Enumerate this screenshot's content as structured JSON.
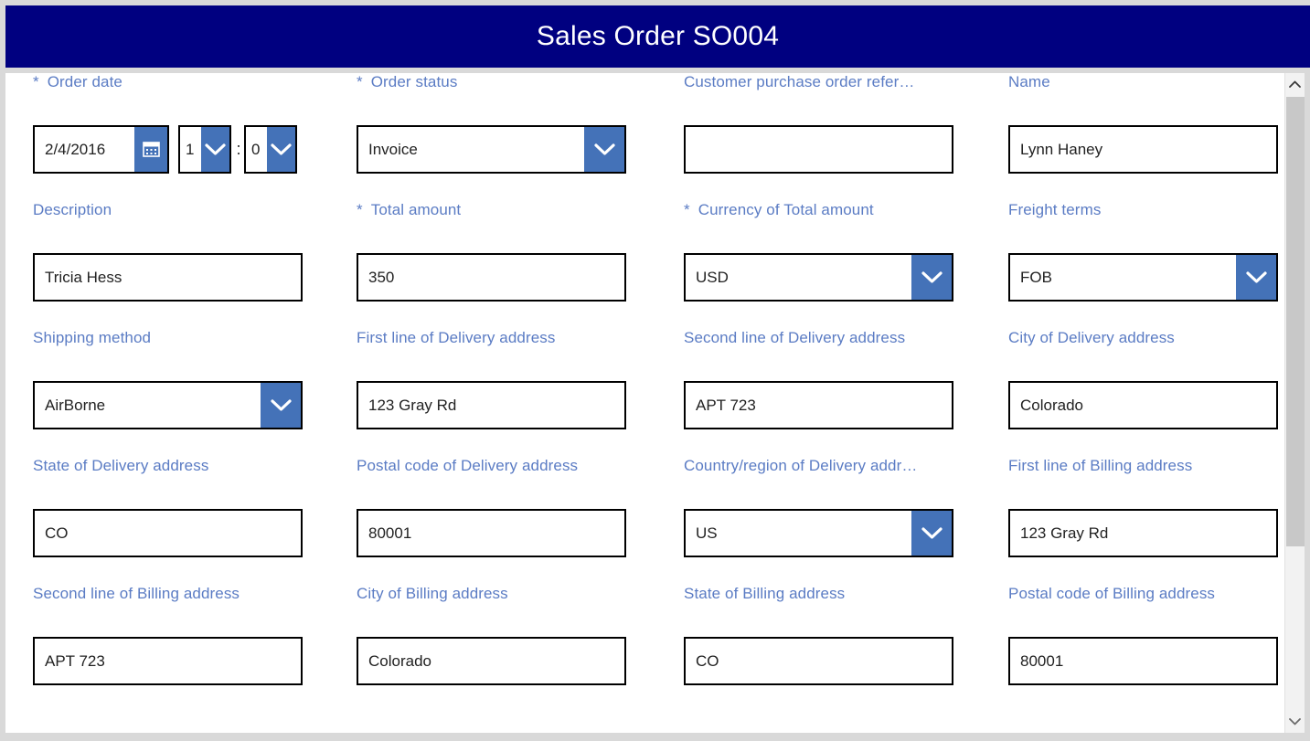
{
  "window": {
    "title": "Sales Order SO004",
    "header_bg": "#000080",
    "header_text_color": "#ffffff",
    "label_color": "#5b7cc4",
    "accent_button_color": "#4472b8",
    "page_bg": "#d9d9d9",
    "surface_bg": "#ffffff"
  },
  "icons": {
    "calendar": "calendar-icon",
    "chevron_down": "chevron-down-icon",
    "scroll_up": "scroll-up-arrow-icon",
    "scroll_down": "scroll-down-arrow-icon"
  },
  "required_marker": "*",
  "time_separator": ":",
  "form": {
    "rows": [
      {
        "fields": [
          {
            "name": "order-date",
            "label": "Order date",
            "required": true,
            "type": "datetime",
            "date_value": "2/4/2016",
            "hour_value": "1",
            "minute_value": "0"
          },
          {
            "name": "order-status",
            "label": "Order status",
            "required": true,
            "type": "combo",
            "value": "Invoice"
          },
          {
            "name": "customer-purchase-order-reference",
            "label": "Customer purchase order refer…",
            "required": false,
            "type": "text",
            "value": ""
          },
          {
            "name": "name",
            "label": "Name",
            "required": false,
            "type": "text",
            "value": "Lynn Haney"
          }
        ]
      },
      {
        "fields": [
          {
            "name": "description",
            "label": "Description",
            "required": false,
            "type": "text",
            "value": "Tricia Hess"
          },
          {
            "name": "total-amount",
            "label": "Total amount",
            "required": true,
            "type": "text",
            "value": "350"
          },
          {
            "name": "currency-of-total-amount",
            "label": "Currency of Total amount",
            "required": true,
            "type": "combo",
            "value": "USD"
          },
          {
            "name": "freight-terms",
            "label": "Freight terms",
            "required": false,
            "type": "combo",
            "value": "FOB"
          }
        ]
      },
      {
        "fields": [
          {
            "name": "shipping-method",
            "label": "Shipping method",
            "required": false,
            "type": "combo",
            "value": "AirBorne"
          },
          {
            "name": "first-line-of-delivery-address",
            "label": "First line of Delivery address",
            "required": false,
            "type": "text",
            "value": "123 Gray Rd"
          },
          {
            "name": "second-line-of-delivery-address",
            "label": "Second line of Delivery address",
            "required": false,
            "type": "text",
            "value": "APT 723"
          },
          {
            "name": "city-of-delivery-address",
            "label": "City of Delivery address",
            "required": false,
            "type": "text",
            "value": "Colorado"
          }
        ]
      },
      {
        "fields": [
          {
            "name": "state-of-delivery-address",
            "label": "State of Delivery address",
            "required": false,
            "type": "text",
            "value": "CO"
          },
          {
            "name": "postal-code-of-delivery-address",
            "label": "Postal code of Delivery address",
            "required": false,
            "type": "text",
            "value": "80001"
          },
          {
            "name": "country-region-of-delivery-address",
            "label": "Country/region of Delivery addr…",
            "required": false,
            "type": "combo",
            "value": "US"
          },
          {
            "name": "first-line-of-billing-address",
            "label": "First line of Billing address",
            "required": false,
            "type": "text",
            "value": "123 Gray Rd"
          }
        ]
      },
      {
        "fields": [
          {
            "name": "second-line-of-billing-address",
            "label": "Second line of Billing address",
            "required": false,
            "type": "text",
            "value": "APT 723"
          },
          {
            "name": "city-of-billing-address",
            "label": "City of Billing address",
            "required": false,
            "type": "text",
            "value": "Colorado"
          },
          {
            "name": "state-of-billing-address",
            "label": "State of Billing address",
            "required": false,
            "type": "text",
            "value": "CO"
          },
          {
            "name": "postal-code-of-billing-address",
            "label": "Postal code of Billing address",
            "required": false,
            "type": "text",
            "value": "80001"
          }
        ]
      }
    ]
  }
}
